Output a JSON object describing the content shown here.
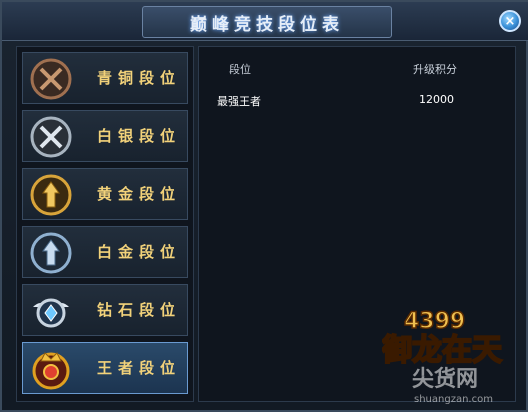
{
  "window": {
    "title": "巅峰竞技段位表",
    "close_icon": "×"
  },
  "tiers": [
    {
      "label": "青铜段位",
      "icon": "bronze-swords-emblem",
      "color": "#a07050"
    },
    {
      "label": "白银段位",
      "icon": "silver-swords-emblem",
      "color": "#a8b4c0"
    },
    {
      "label": "黄金段位",
      "icon": "gold-emblem",
      "color": "#d8a43a"
    },
    {
      "label": "白金段位",
      "icon": "platinum-emblem",
      "color": "#8fb0d0"
    },
    {
      "label": "钻石段位",
      "icon": "diamond-winged-emblem",
      "color": "#6ec8ff"
    },
    {
      "label": "王者段位",
      "icon": "king-crown-emblem",
      "color": "#e0a020",
      "active": true
    }
  ],
  "table": {
    "headers": [
      "段位",
      "升级积分"
    ],
    "rows": [
      [
        "最强王者",
        "12000"
      ]
    ]
  },
  "watermark": {
    "brand_number": "4399",
    "brand_name": "御龙在天",
    "site_name": "尖货网",
    "site_url": "shuangzan.com"
  }
}
